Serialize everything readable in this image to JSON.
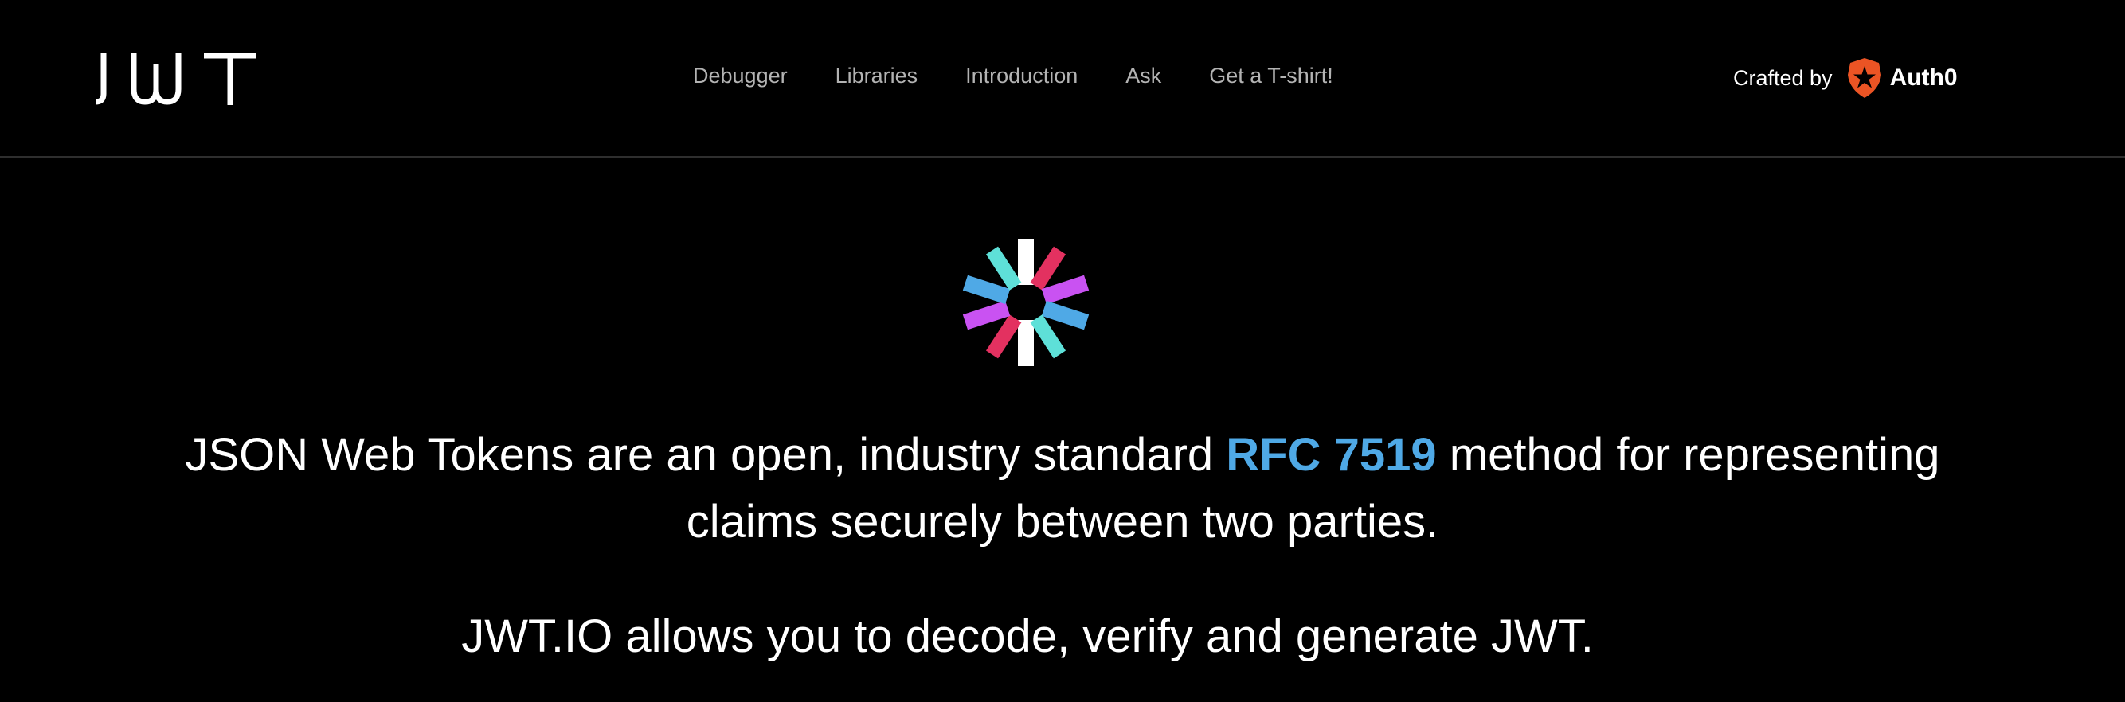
{
  "header": {
    "logo_text": "JWT",
    "nav": [
      {
        "label": "Debugger"
      },
      {
        "label": "Libraries"
      },
      {
        "label": "Introduction"
      },
      {
        "label": "Ask"
      },
      {
        "label": "Get a T-shirt!"
      }
    ],
    "crafted_by_label": "Crafted by",
    "brand_name": "Auth0"
  },
  "hero": {
    "icon": "jwt-logo-icon",
    "headline_part1": "JSON Web Tokens are an open, industry standard",
    "rfc_link": "RFC 7519",
    "headline_part2": "method for representing",
    "headline_line2": "claims securely between two parties.",
    "subline": "JWT.IO allows you to decode, verify and generate JWT."
  },
  "colors": {
    "background": "#000000",
    "nav_text": "#b3b3b3",
    "link_blue": "#4fa9e6",
    "jwt_white": "#ffffff",
    "jwt_red": "#e33160",
    "jwt_purple": "#c952f2",
    "jwt_blue": "#4fa9e6",
    "jwt_cyan": "#5ee0d8",
    "auth0_orange": "#eb5424"
  }
}
